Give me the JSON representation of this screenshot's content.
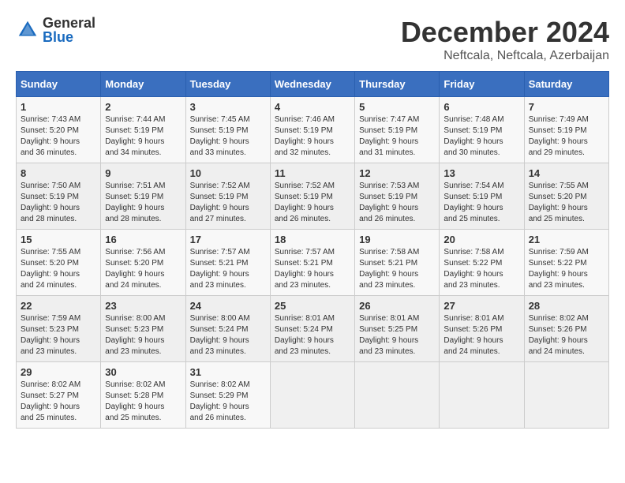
{
  "logo": {
    "general": "General",
    "blue": "Blue"
  },
  "title": {
    "month": "December 2024",
    "location": "Neftcala, Neftcala, Azerbaijan"
  },
  "weekdays": [
    "Sunday",
    "Monday",
    "Tuesday",
    "Wednesday",
    "Thursday",
    "Friday",
    "Saturday"
  ],
  "weeks": [
    [
      {
        "day": "1",
        "sunrise": "Sunrise: 7:43 AM",
        "sunset": "Sunset: 5:20 PM",
        "daylight": "Daylight: 9 hours and 36 minutes."
      },
      {
        "day": "2",
        "sunrise": "Sunrise: 7:44 AM",
        "sunset": "Sunset: 5:19 PM",
        "daylight": "Daylight: 9 hours and 34 minutes."
      },
      {
        "day": "3",
        "sunrise": "Sunrise: 7:45 AM",
        "sunset": "Sunset: 5:19 PM",
        "daylight": "Daylight: 9 hours and 33 minutes."
      },
      {
        "day": "4",
        "sunrise": "Sunrise: 7:46 AM",
        "sunset": "Sunset: 5:19 PM",
        "daylight": "Daylight: 9 hours and 32 minutes."
      },
      {
        "day": "5",
        "sunrise": "Sunrise: 7:47 AM",
        "sunset": "Sunset: 5:19 PM",
        "daylight": "Daylight: 9 hours and 31 minutes."
      },
      {
        "day": "6",
        "sunrise": "Sunrise: 7:48 AM",
        "sunset": "Sunset: 5:19 PM",
        "daylight": "Daylight: 9 hours and 30 minutes."
      },
      {
        "day": "7",
        "sunrise": "Sunrise: 7:49 AM",
        "sunset": "Sunset: 5:19 PM",
        "daylight": "Daylight: 9 hours and 29 minutes."
      }
    ],
    [
      {
        "day": "8",
        "sunrise": "Sunrise: 7:50 AM",
        "sunset": "Sunset: 5:19 PM",
        "daylight": "Daylight: 9 hours and 28 minutes."
      },
      {
        "day": "9",
        "sunrise": "Sunrise: 7:51 AM",
        "sunset": "Sunset: 5:19 PM",
        "daylight": "Daylight: 9 hours and 28 minutes."
      },
      {
        "day": "10",
        "sunrise": "Sunrise: 7:52 AM",
        "sunset": "Sunset: 5:19 PM",
        "daylight": "Daylight: 9 hours and 27 minutes."
      },
      {
        "day": "11",
        "sunrise": "Sunrise: 7:52 AM",
        "sunset": "Sunset: 5:19 PM",
        "daylight": "Daylight: 9 hours and 26 minutes."
      },
      {
        "day": "12",
        "sunrise": "Sunrise: 7:53 AM",
        "sunset": "Sunset: 5:19 PM",
        "daylight": "Daylight: 9 hours and 26 minutes."
      },
      {
        "day": "13",
        "sunrise": "Sunrise: 7:54 AM",
        "sunset": "Sunset: 5:19 PM",
        "daylight": "Daylight: 9 hours and 25 minutes."
      },
      {
        "day": "14",
        "sunrise": "Sunrise: 7:55 AM",
        "sunset": "Sunset: 5:20 PM",
        "daylight": "Daylight: 9 hours and 25 minutes."
      }
    ],
    [
      {
        "day": "15",
        "sunrise": "Sunrise: 7:55 AM",
        "sunset": "Sunset: 5:20 PM",
        "daylight": "Daylight: 9 hours and 24 minutes."
      },
      {
        "day": "16",
        "sunrise": "Sunrise: 7:56 AM",
        "sunset": "Sunset: 5:20 PM",
        "daylight": "Daylight: 9 hours and 24 minutes."
      },
      {
        "day": "17",
        "sunrise": "Sunrise: 7:57 AM",
        "sunset": "Sunset: 5:21 PM",
        "daylight": "Daylight: 9 hours and 23 minutes."
      },
      {
        "day": "18",
        "sunrise": "Sunrise: 7:57 AM",
        "sunset": "Sunset: 5:21 PM",
        "daylight": "Daylight: 9 hours and 23 minutes."
      },
      {
        "day": "19",
        "sunrise": "Sunrise: 7:58 AM",
        "sunset": "Sunset: 5:21 PM",
        "daylight": "Daylight: 9 hours and 23 minutes."
      },
      {
        "day": "20",
        "sunrise": "Sunrise: 7:58 AM",
        "sunset": "Sunset: 5:22 PM",
        "daylight": "Daylight: 9 hours and 23 minutes."
      },
      {
        "day": "21",
        "sunrise": "Sunrise: 7:59 AM",
        "sunset": "Sunset: 5:22 PM",
        "daylight": "Daylight: 9 hours and 23 minutes."
      }
    ],
    [
      {
        "day": "22",
        "sunrise": "Sunrise: 7:59 AM",
        "sunset": "Sunset: 5:23 PM",
        "daylight": "Daylight: 9 hours and 23 minutes."
      },
      {
        "day": "23",
        "sunrise": "Sunrise: 8:00 AM",
        "sunset": "Sunset: 5:23 PM",
        "daylight": "Daylight: 9 hours and 23 minutes."
      },
      {
        "day": "24",
        "sunrise": "Sunrise: 8:00 AM",
        "sunset": "Sunset: 5:24 PM",
        "daylight": "Daylight: 9 hours and 23 minutes."
      },
      {
        "day": "25",
        "sunrise": "Sunrise: 8:01 AM",
        "sunset": "Sunset: 5:24 PM",
        "daylight": "Daylight: 9 hours and 23 minutes."
      },
      {
        "day": "26",
        "sunrise": "Sunrise: 8:01 AM",
        "sunset": "Sunset: 5:25 PM",
        "daylight": "Daylight: 9 hours and 23 minutes."
      },
      {
        "day": "27",
        "sunrise": "Sunrise: 8:01 AM",
        "sunset": "Sunset: 5:26 PM",
        "daylight": "Daylight: 9 hours and 24 minutes."
      },
      {
        "day": "28",
        "sunrise": "Sunrise: 8:02 AM",
        "sunset": "Sunset: 5:26 PM",
        "daylight": "Daylight: 9 hours and 24 minutes."
      }
    ],
    [
      {
        "day": "29",
        "sunrise": "Sunrise: 8:02 AM",
        "sunset": "Sunset: 5:27 PM",
        "daylight": "Daylight: 9 hours and 25 minutes."
      },
      {
        "day": "30",
        "sunrise": "Sunrise: 8:02 AM",
        "sunset": "Sunset: 5:28 PM",
        "daylight": "Daylight: 9 hours and 25 minutes."
      },
      {
        "day": "31",
        "sunrise": "Sunrise: 8:02 AM",
        "sunset": "Sunset: 5:29 PM",
        "daylight": "Daylight: 9 hours and 26 minutes."
      },
      null,
      null,
      null,
      null
    ]
  ]
}
